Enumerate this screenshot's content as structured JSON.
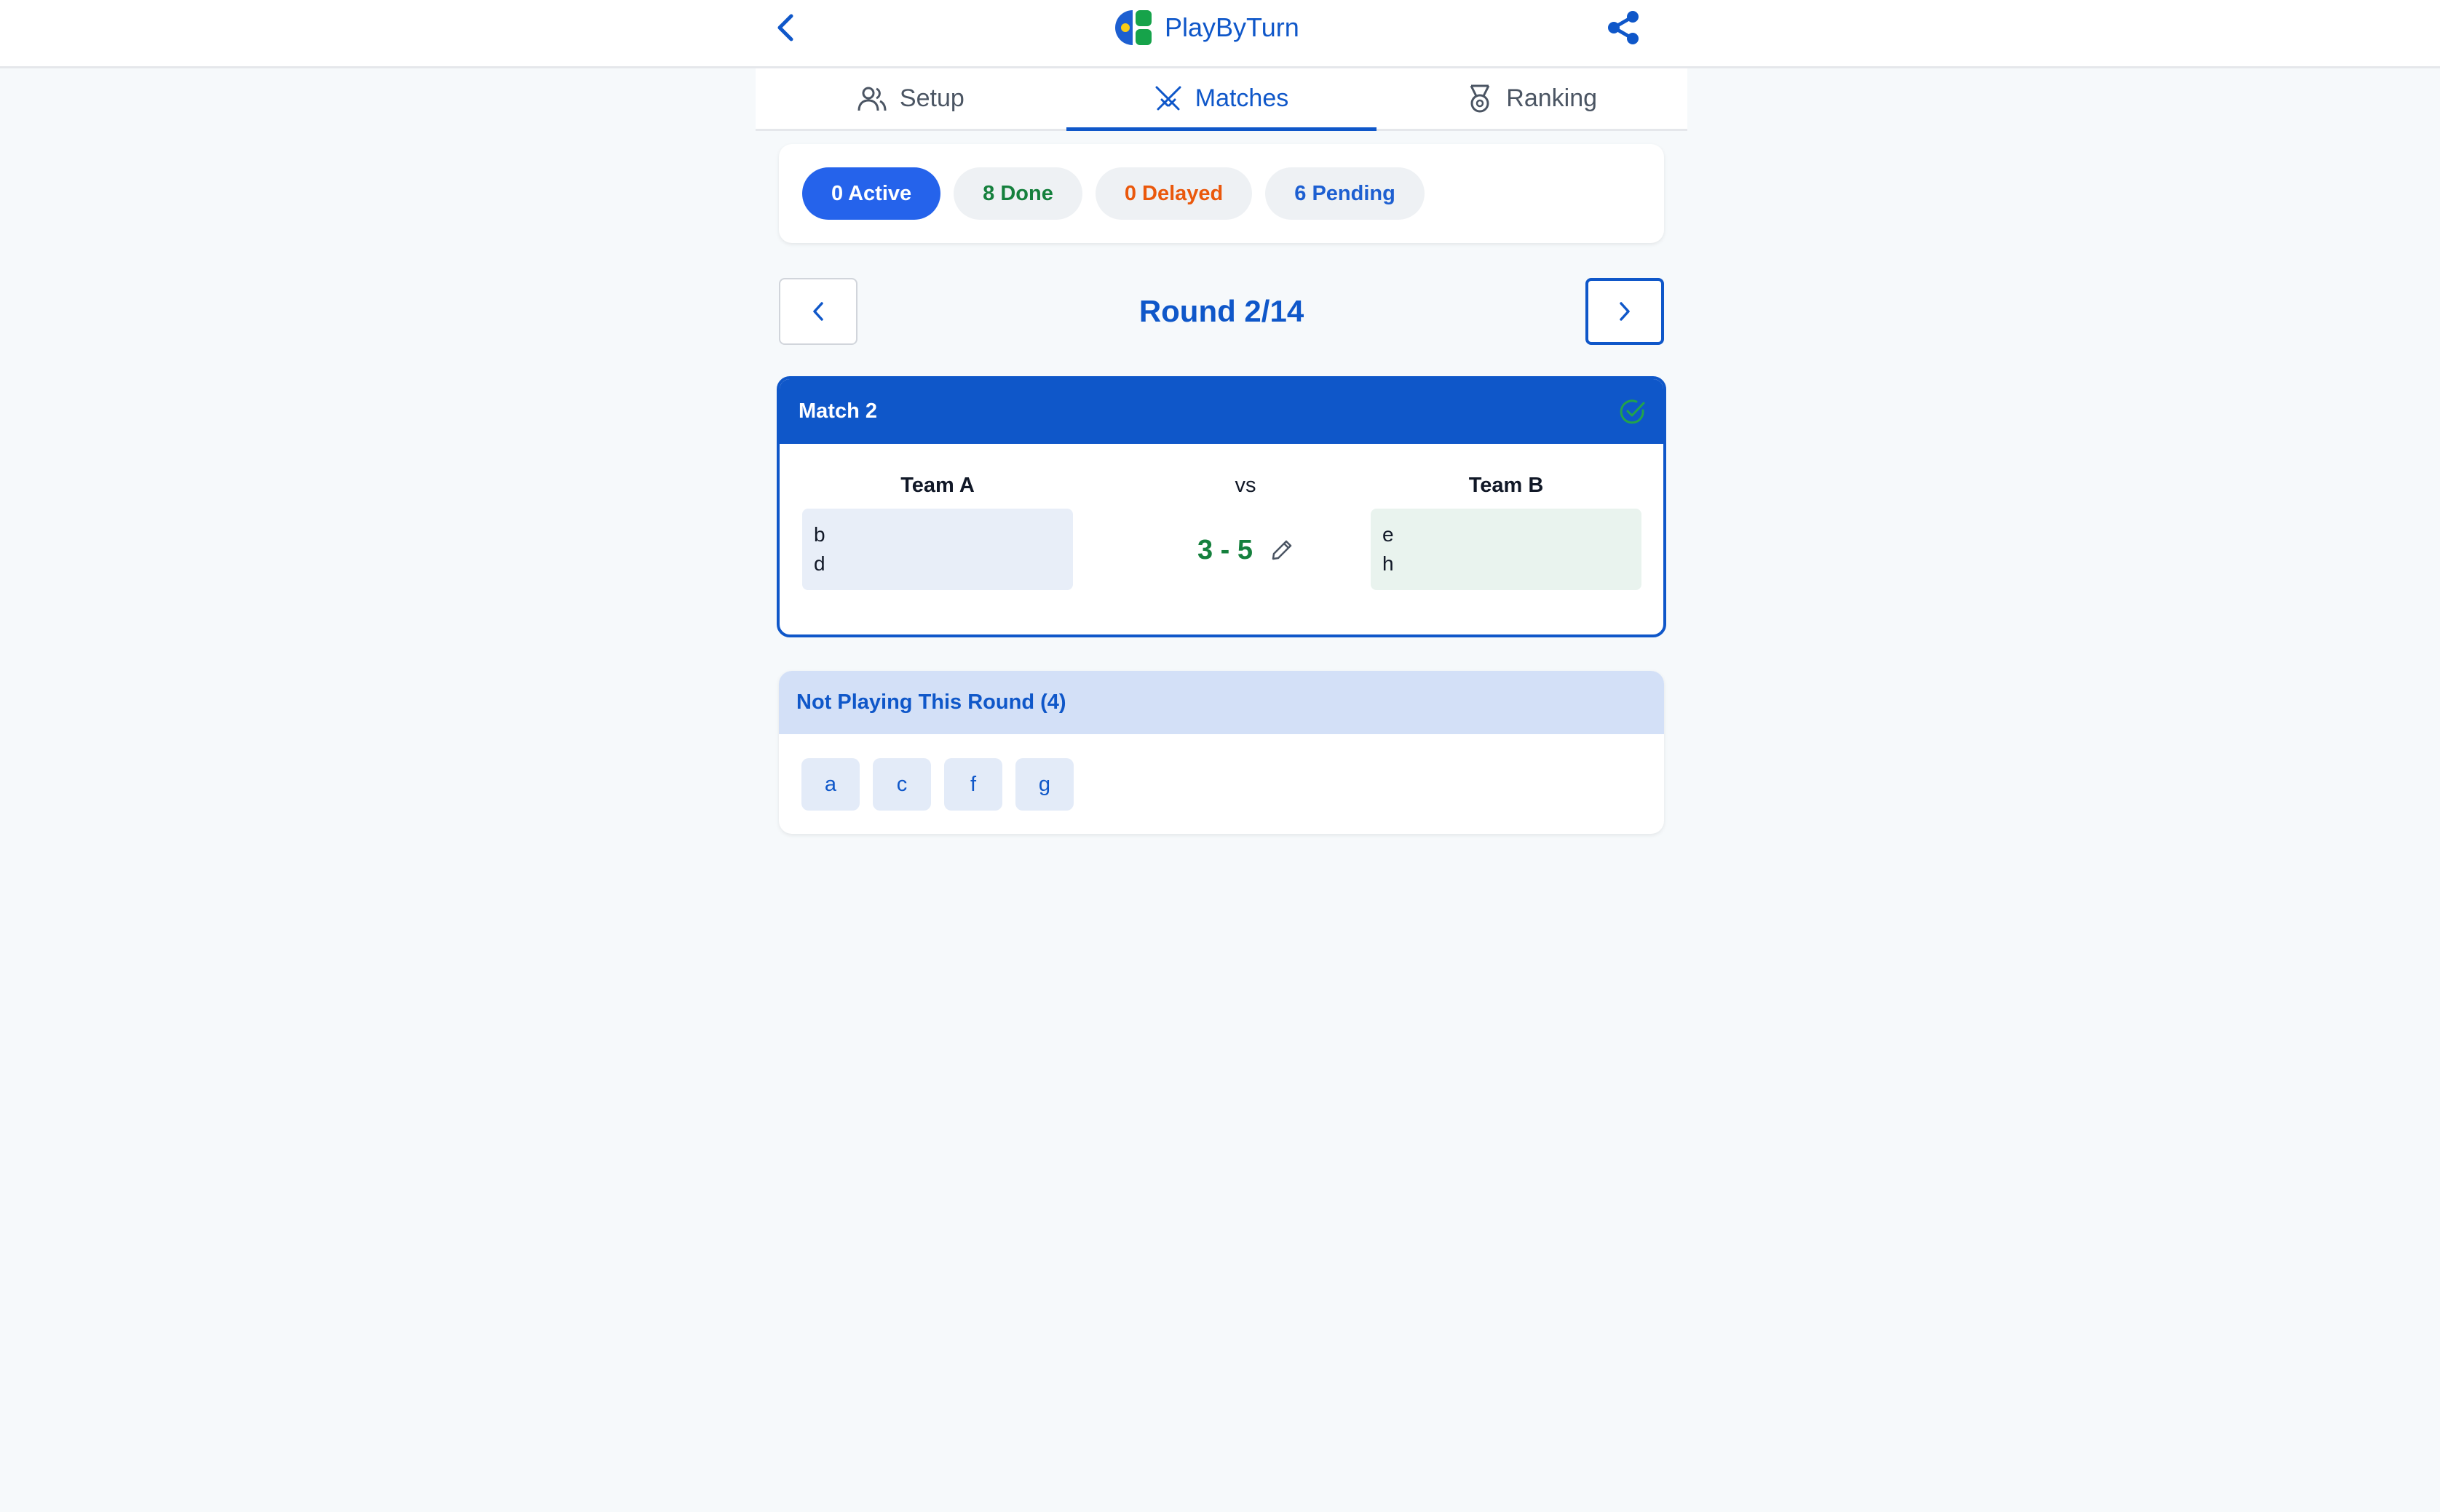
{
  "app": {
    "name": "PlayByTurn"
  },
  "tabs": [
    {
      "label": "Setup",
      "active": false
    },
    {
      "label": "Matches",
      "active": true
    },
    {
      "label": "Ranking",
      "active": false
    }
  ],
  "status": {
    "active": "0 Active",
    "done": "8 Done",
    "delayed": "0 Delayed",
    "pending": "6 Pending"
  },
  "round": {
    "title": "Round 2/14"
  },
  "match": {
    "title": "Match 2",
    "team_a": {
      "label": "Team A",
      "players": [
        "b",
        "d"
      ]
    },
    "vs": "vs",
    "score": "3 - 5",
    "team_b": {
      "label": "Team B",
      "players": [
        "e",
        "h"
      ]
    }
  },
  "sitting_out": {
    "title": "Not Playing This Round (4)",
    "players": [
      "a",
      "c",
      "f",
      "g"
    ]
  },
  "colors": {
    "primary": "#0f57c9",
    "done": "#15803d",
    "delayed": "#ea580c",
    "background": "#f6f9fb"
  }
}
